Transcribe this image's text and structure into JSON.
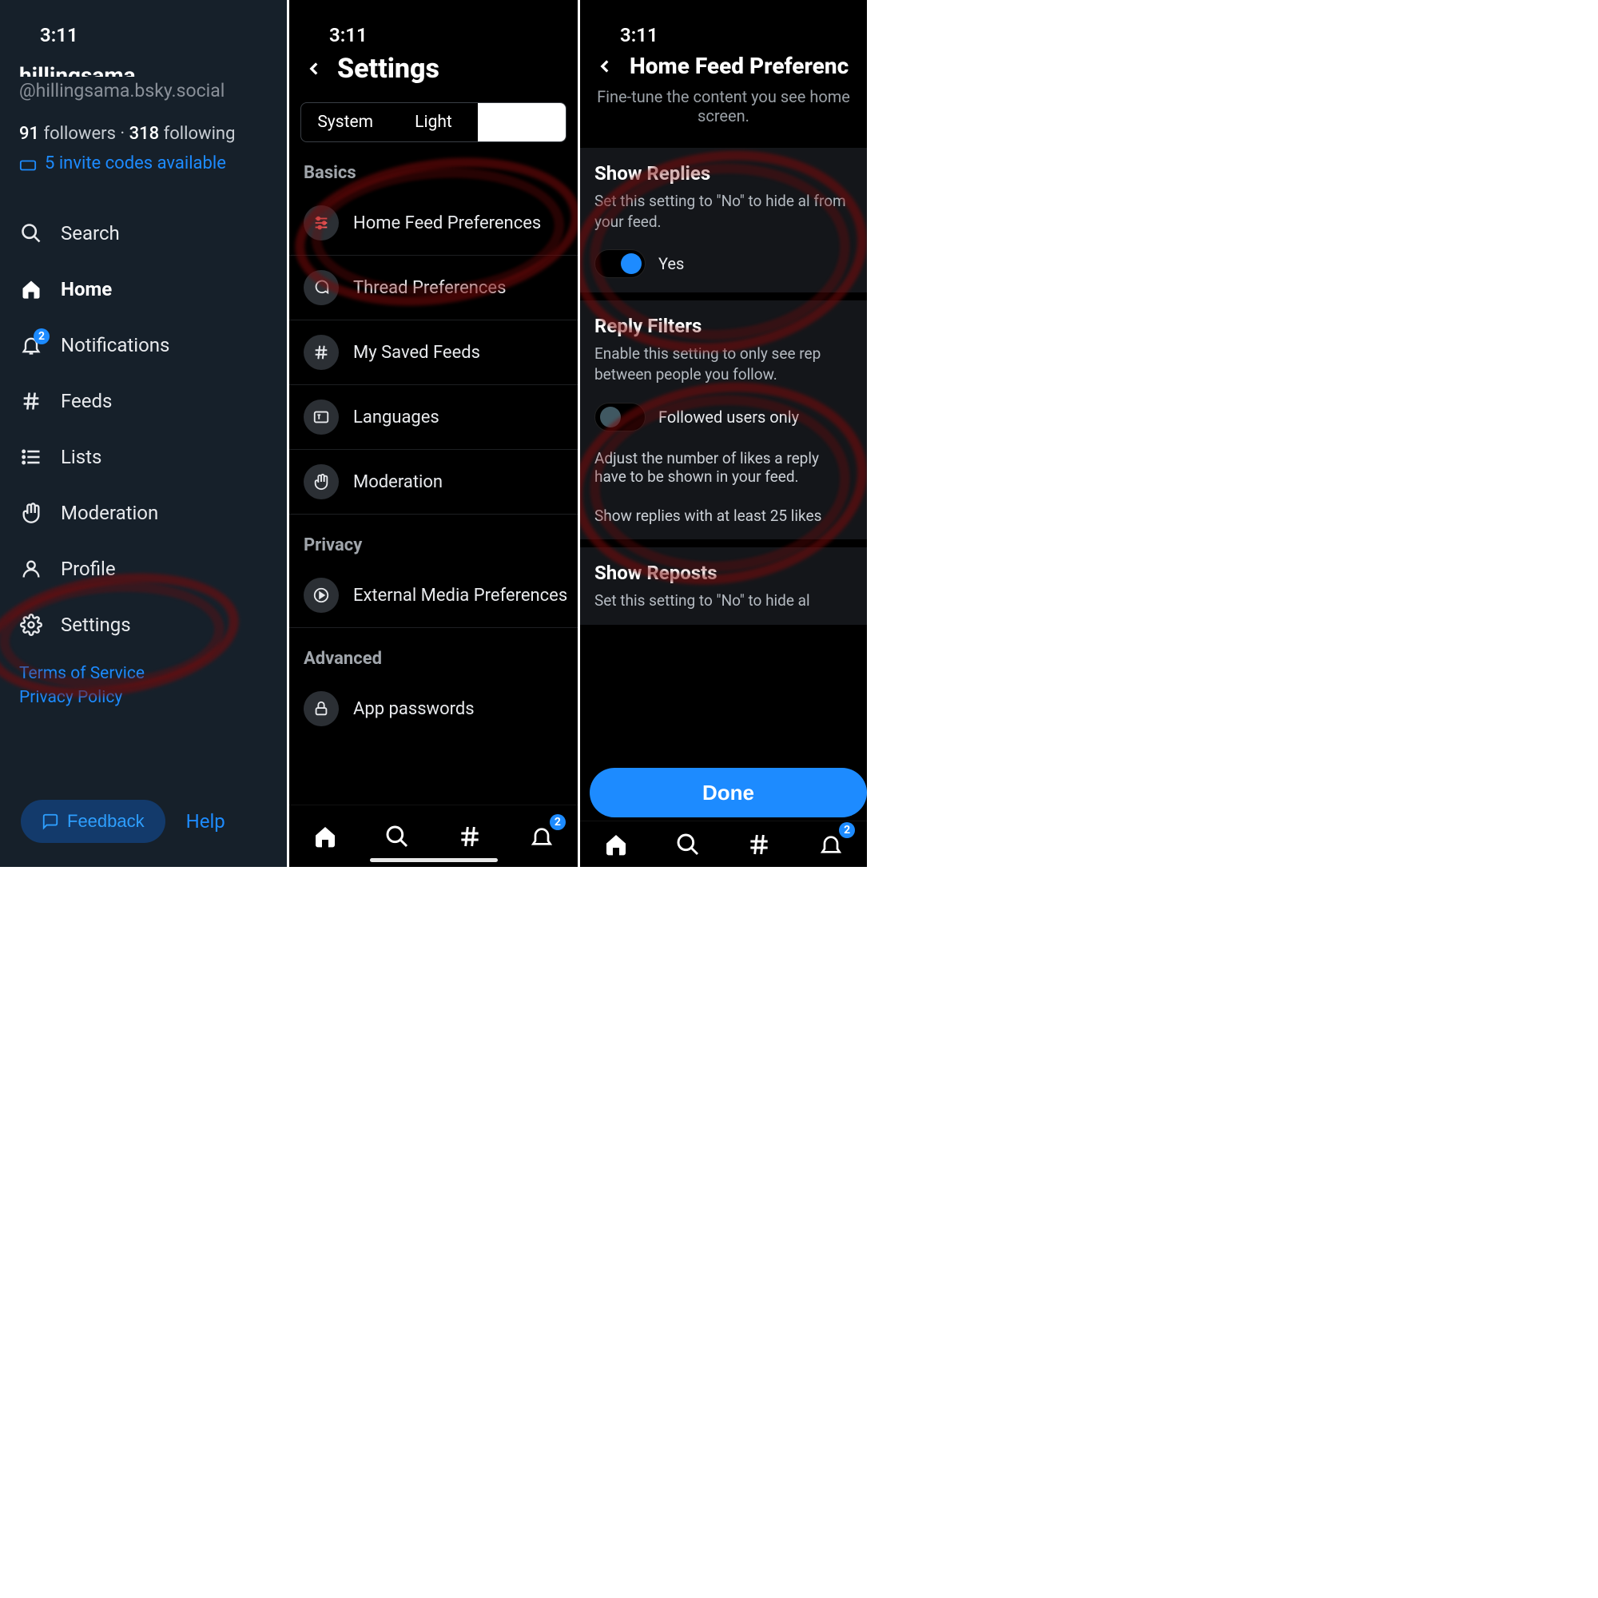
{
  "time": "3:11",
  "panel1": {
    "username_display": "hillingsama",
    "handle": "@hillingsama.bsky.social",
    "followers_count": "91",
    "followers_label": "followers",
    "dot": " · ",
    "following_count": "318",
    "following_label": "following",
    "invite_label": "5 invite codes available",
    "nav": {
      "search": "Search",
      "home": "Home",
      "notifications": "Notifications",
      "notif_badge": "2",
      "feeds": "Feeds",
      "lists": "Lists",
      "moderation": "Moderation",
      "profile": "Profile",
      "settings": "Settings"
    },
    "tos": "Terms of Service",
    "privacy": "Privacy Policy",
    "feedback": "Feedback",
    "help": "Help"
  },
  "panel2": {
    "title": "Settings",
    "seg": {
      "a": "System",
      "b": "Light",
      "c": ""
    },
    "sections": {
      "basics": "Basics",
      "privacy": "Privacy",
      "advanced": "Advanced"
    },
    "rows": {
      "home_feed": "Home Feed Preferences",
      "thread": "Thread Preferences",
      "saved": "My Saved Feeds",
      "languages": "Languages",
      "moderation": "Moderation",
      "ext_media": "External Media Preferences",
      "app_pw": "App passwords"
    },
    "bottom_badge": "2"
  },
  "panel3": {
    "title": "Home Feed Preferenc",
    "subtitle": "Fine-tune the content you see home screen.",
    "card1": {
      "title": "Show Replies",
      "desc": "Set this setting to \"No\" to hide al from your feed.",
      "switch_label": "Yes"
    },
    "card2": {
      "title": "Reply Filters",
      "desc": "Enable this setting to only see rep between people you follow.",
      "switch_label": "Followed users only",
      "note": "Adjust the number of likes a reply have to be shown in your feed.",
      "slider_text": "Show replies with at least 25 likes"
    },
    "card3": {
      "title": "Show Reposts",
      "desc": "Set this setting to \"No\" to hide al"
    },
    "done": "Done",
    "bottom_badge": "2"
  }
}
